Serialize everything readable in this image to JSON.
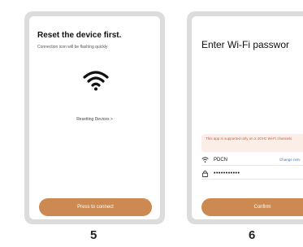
{
  "step5": {
    "title": "Reset the device first.",
    "subtitle": "Connection icon will be flashing quickly",
    "icon": "wifi-icon",
    "link": "Resetting Devices >",
    "button": "Press to connect",
    "number": "5"
  },
  "step6": {
    "title": "Enter Wi-Fi passwor",
    "notice": "This app is supported only on 2.4GHz Wi-Fi channels",
    "notice_chevron": ">",
    "ssid": "PDCN",
    "change": "Change netv",
    "password": "•••••••••••",
    "button": "Confirm",
    "number": "6"
  },
  "colors": {
    "accent": "#cc8a52",
    "notice_bg": "#fbeee9",
    "notice_text": "#d15a3e",
    "link": "#3b7bd8"
  }
}
